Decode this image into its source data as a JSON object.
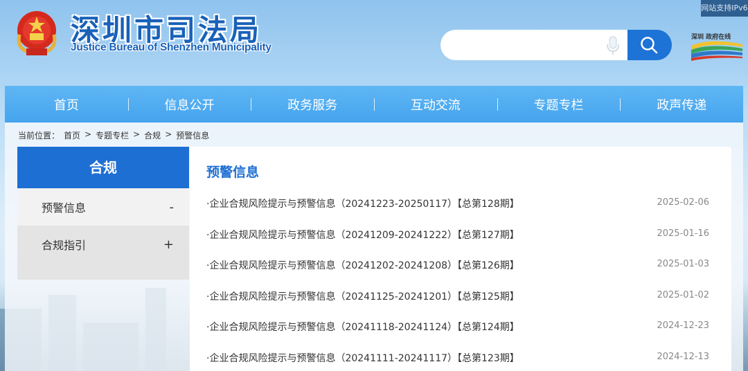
{
  "ipv6_badge": "网站支持IPv6",
  "header": {
    "title_cn": "深圳市司法局",
    "title_en": "Justice Bureau of Shenzhen Municipality",
    "emblem_icon": "national-emblem-icon",
    "search_placeholder": "",
    "mic_icon": "microphone-icon",
    "search_icon": "magnifier-icon",
    "right_logo": "shenzhen-gov-logo"
  },
  "nav": [
    "首页",
    "信息公开",
    "政务服务",
    "互动交流",
    "专题专栏",
    "政声传递"
  ],
  "breadcrumb": {
    "prefix": "当前位置：",
    "items": [
      "首页",
      "专题专栏",
      "合规",
      "预警信息"
    ],
    "sep": ">"
  },
  "sidebar": {
    "title": "合规",
    "items": [
      {
        "label": "预警信息",
        "sign": "-"
      },
      {
        "label": "合规指引",
        "sign": "+"
      }
    ]
  },
  "main": {
    "title": "预警信息",
    "list": [
      {
        "title": "·企业合规风险提示与预警信息（20241223-20250117）【总第128期】",
        "date": "2025-02-06"
      },
      {
        "title": "·企业合规风险提示与预警信息（20241209-20241222）【总第127期】",
        "date": "2025-01-16"
      },
      {
        "title": "·企业合规风险提示与预警信息（20241202-20241208）【总第126期】",
        "date": "2025-01-03"
      },
      {
        "title": "·企业合规风险提示与预警信息（20241125-20241201）【总第125期】",
        "date": "2025-01-02"
      },
      {
        "title": "·企业合规风险提示与预警信息（20241118-20241124）【总第124期】",
        "date": "2024-12-23"
      },
      {
        "title": "·企业合规风险提示与预警信息（20241111-20241117）【总第123期】",
        "date": "2024-12-13"
      }
    ]
  },
  "colors": {
    "primary": "#1d6fd4",
    "nav": "#4aa8ef",
    "title": "#1961b8"
  }
}
